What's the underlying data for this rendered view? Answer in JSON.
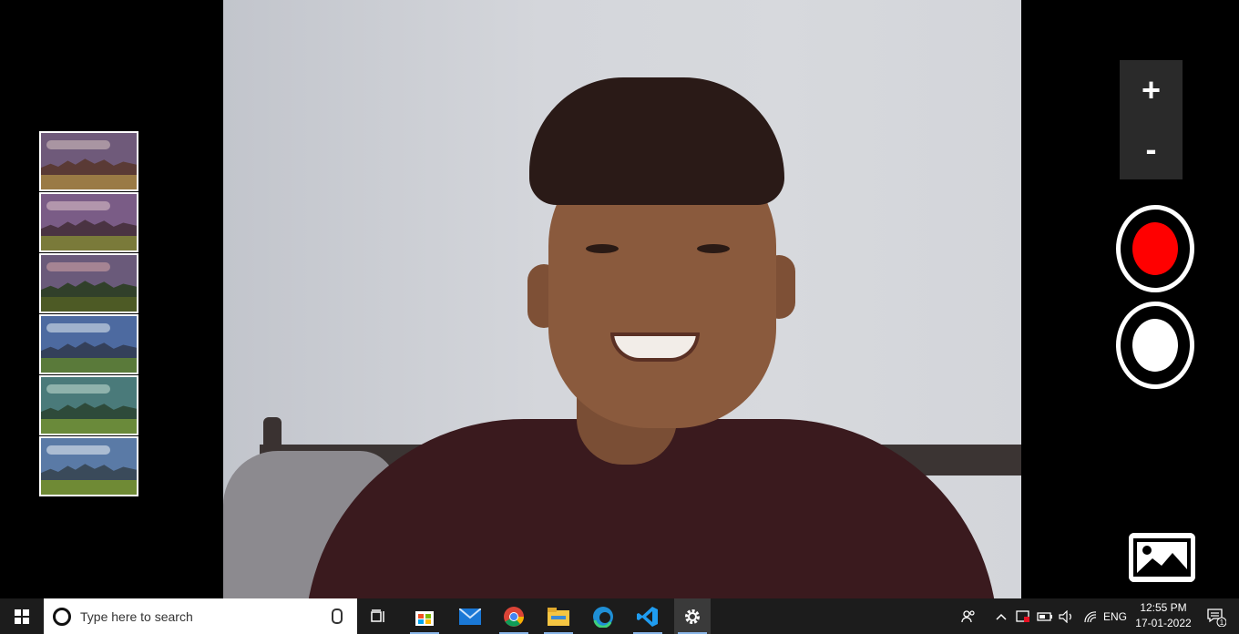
{
  "filters": {
    "items": [
      {
        "name": "filter-1",
        "sky": "#6f5a7a",
        "cloud": "#d9c7c2",
        "mtn": "#5a3a35",
        "ground": "#9a7a45"
      },
      {
        "name": "filter-2",
        "sky": "#7a5c86",
        "cloud": "#e0c6cc",
        "mtn": "#4a3342",
        "ground": "#7a7a3a"
      },
      {
        "name": "filter-3",
        "sky": "#6a5a7a",
        "cloud": "#d6a8a8",
        "mtn": "#31402a",
        "ground": "#4d5a25"
      },
      {
        "name": "filter-4",
        "sky": "#4d6aa0",
        "cloud": "#e6ecf3",
        "mtn": "#34405a",
        "ground": "#5a7a3a"
      },
      {
        "name": "filter-5",
        "sky": "#4a7a7a",
        "cloud": "#c8e0d6",
        "mtn": "#2e4a3a",
        "ground": "#6a8a3a"
      },
      {
        "name": "filter-6",
        "sky": "#5a7aa6",
        "cloud": "#eef2f6",
        "mtn": "#3a4a5a",
        "ground": "#6f8a35"
      }
    ]
  },
  "controls": {
    "zoom_in": "+",
    "zoom_out": "-"
  },
  "taskbar": {
    "search_placeholder": "Type here to search",
    "language": "ENG",
    "time": "12:55 PM",
    "date": "17-01-2022",
    "notification_count": "1"
  },
  "colors": {
    "record": "#ff0000",
    "taskbar": "#1c1c1c"
  }
}
